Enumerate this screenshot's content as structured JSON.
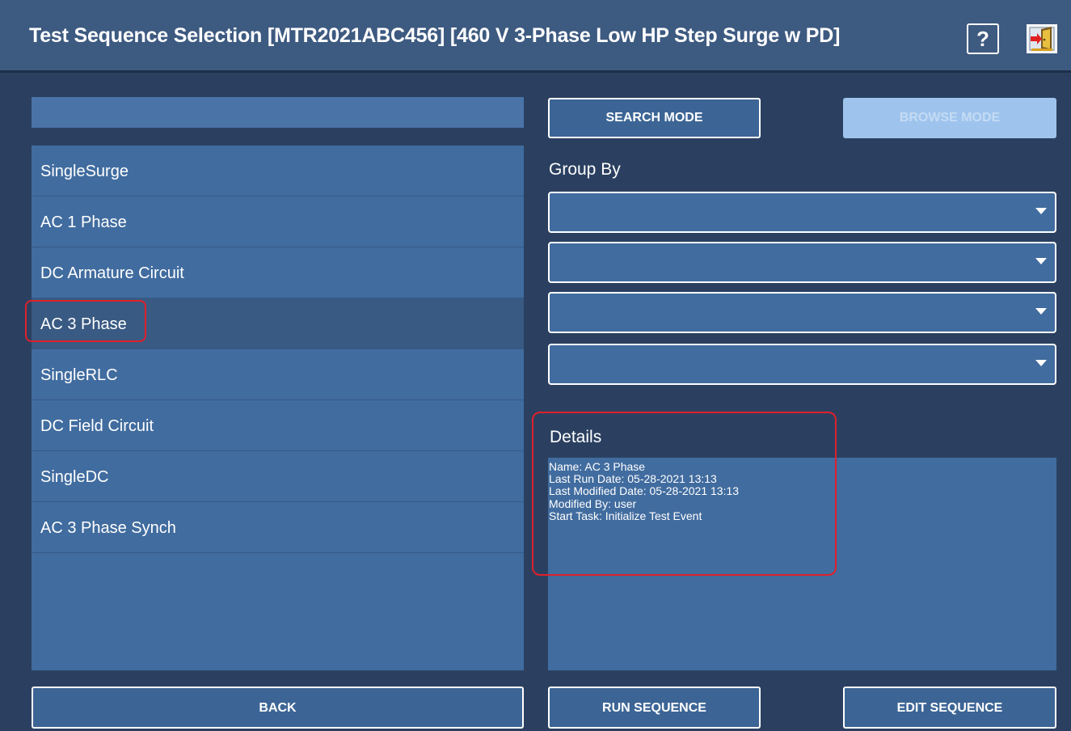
{
  "window": {
    "title": "Test Sequence Selection  [MTR2021ABC456] [460 V 3-Phase Low HP Step Surge w PD]",
    "help_label": "?"
  },
  "search": {
    "value": ""
  },
  "sequence_list": {
    "items": [
      {
        "label": "SingleSurge"
      },
      {
        "label": "AC 1 Phase"
      },
      {
        "label": "DC Armature Circuit"
      },
      {
        "label": "AC 3 Phase",
        "selected": true
      },
      {
        "label": "SingleRLC"
      },
      {
        "label": "DC Field Circuit"
      },
      {
        "label": "SingleDC"
      },
      {
        "label": "AC 3 Phase Synch"
      }
    ]
  },
  "mode": {
    "search_label": "SEARCH MODE",
    "browse_label": "BROWSE MODE",
    "active": "browse"
  },
  "group_by": {
    "label": "Group By",
    "selects": [
      "",
      "",
      "",
      ""
    ]
  },
  "details": {
    "label": "Details",
    "lines": [
      "Name: AC 3 Phase",
      "Last Run Date: 05-28-2021 13:13",
      "Last Modified Date: 05-28-2021 13:13",
      "Modified By: user",
      "Start Task: Initialize Test Event"
    ]
  },
  "footer": {
    "back_label": "BACK",
    "run_label": "RUN SEQUENCE",
    "edit_label": "EDIT SEQUENCE"
  },
  "colors": {
    "background": "#2b4060",
    "panel": "#416c9f",
    "highlight": "#e0202a",
    "browse_disabled": "#9ec4ee"
  },
  "icons": {
    "help": "help-icon",
    "exit": "exit-door-icon",
    "dropdown": "chevron-down-icon"
  }
}
